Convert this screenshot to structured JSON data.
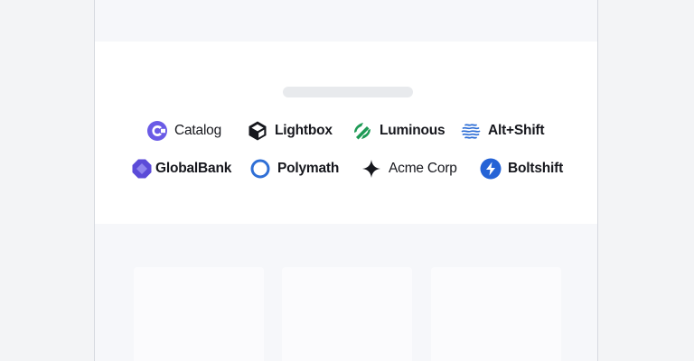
{
  "logos_row_1": [
    {
      "name": "Catalog",
      "icon": "catalog-c-icon",
      "color": "#5b4bd8"
    },
    {
      "name": "Lightbox",
      "icon": "cube-icon",
      "color": "#16171d"
    },
    {
      "name": "Luminous",
      "icon": "luminous-leaf-icon",
      "color": "#1e9a55"
    },
    {
      "name": "Alt+Shift",
      "icon": "waves-globe-icon",
      "color": "#2f6fd6"
    }
  ],
  "logos_row_2": [
    {
      "name": "GlobalBank",
      "icon": "octagon-globe-icon",
      "color": "#5b4bd8"
    },
    {
      "name": "Polymath",
      "icon": "ring-icon",
      "color": "#2f6fd6"
    },
    {
      "name": "Acme Corp",
      "icon": "sparkle-star-icon",
      "color": "#16171d"
    },
    {
      "name": "Boltshift",
      "icon": "bolt-circle-icon",
      "color": "#2f6fd6"
    }
  ]
}
